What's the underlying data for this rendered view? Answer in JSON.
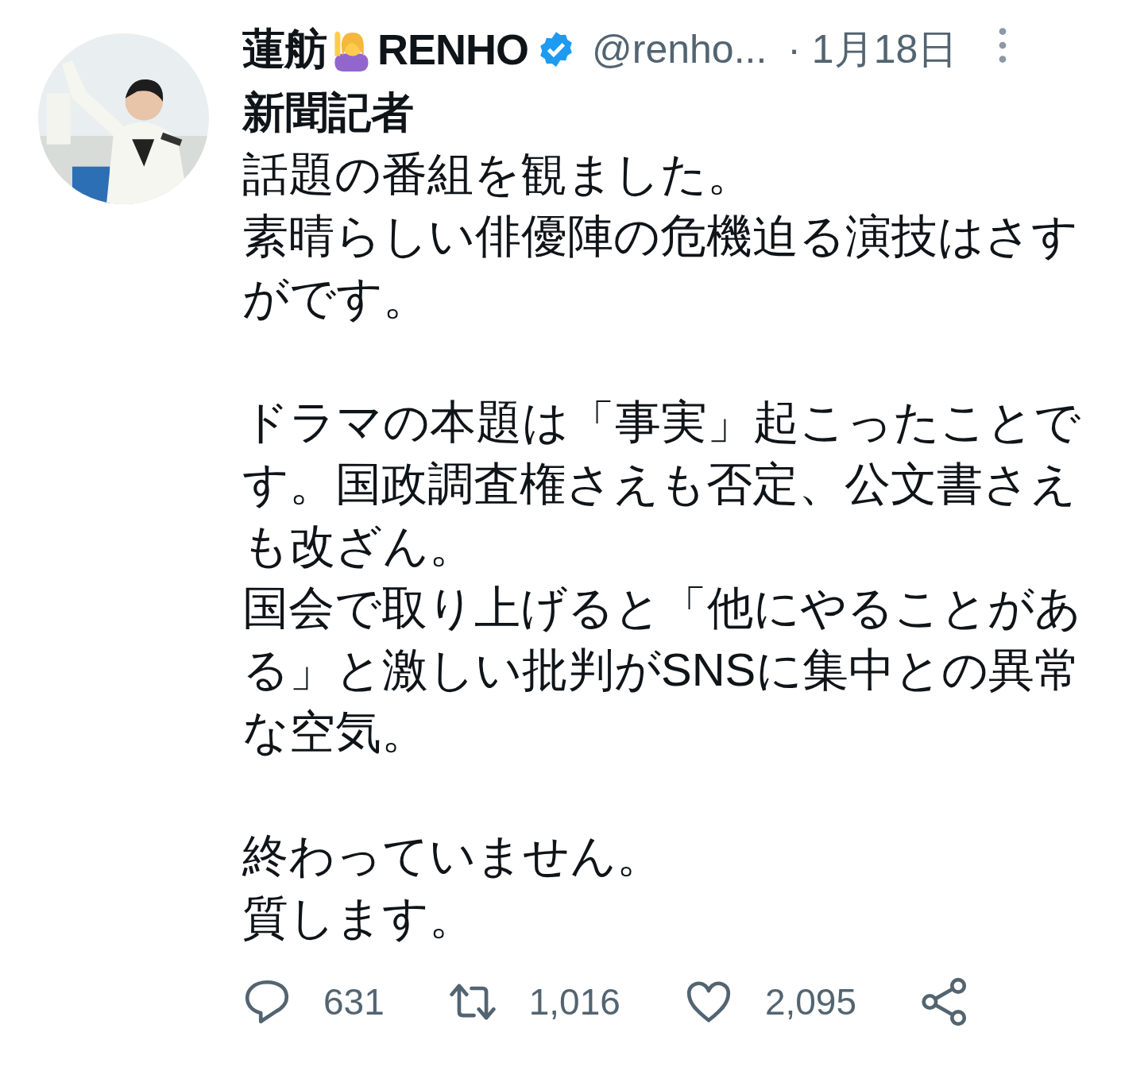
{
  "tweet": {
    "name_first": "蓮舫",
    "name_second": "RENHO",
    "verified": true,
    "handle": "@renho...",
    "date": "· 1月18日",
    "name_line_2": "新聞記者",
    "paragraphs": [
      {
        "lines": [
          "話題の番組を観ました。",
          "素晴らしい俳優陣の危機迫る演技はさすがです。"
        ]
      },
      {
        "lines": [
          "ドラマの本題は「事実」起こったことです。国政調査権さえも否定、公文書さえも改ざん。",
          "国会で取り上げると「他にやることがある」と激しい批判がSNSに集中との異常な空気。"
        ]
      },
      {
        "lines": [
          "終わっていません。",
          "質します。"
        ]
      }
    ],
    "actions": [
      {
        "kind": "reply",
        "count": "631"
      },
      {
        "kind": "retweet",
        "count": "1,016"
      },
      {
        "kind": "like",
        "count": "2,095"
      },
      {
        "kind": "share"
      }
    ]
  }
}
